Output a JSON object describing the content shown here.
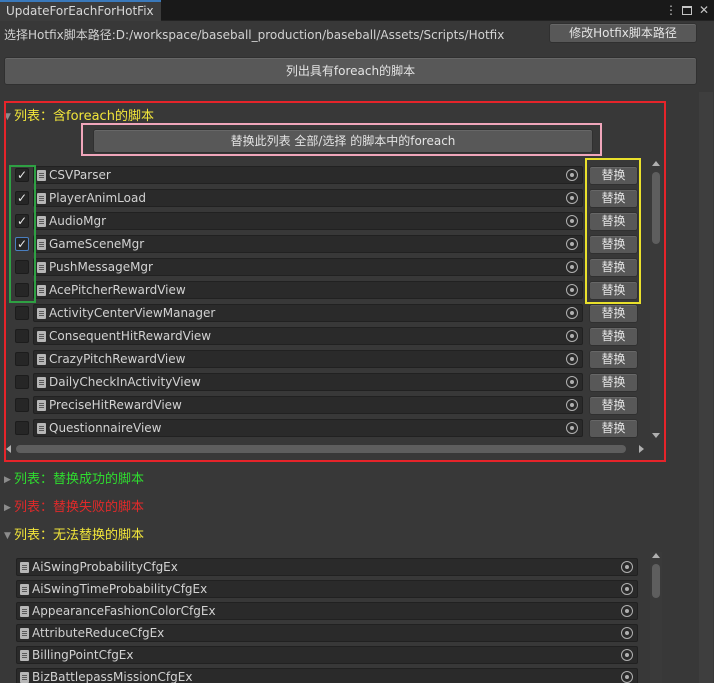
{
  "window": {
    "tab_title": "UpdateForEachForHotFix",
    "menu_icon": "kebab-menu-icon",
    "maximize_icon": "maximize-icon",
    "close_icon": "close-icon"
  },
  "header": {
    "path_label": "选择Hotfix脚本路径:",
    "path_value": "D:/workspace/baseball_production/baseball/Assets/Scripts/Hotfix",
    "modify_button": "修改Hotfix脚本路径",
    "list_button": "列出具有foreach的脚本"
  },
  "sections": {
    "foreach": {
      "label": "列表：含foreach的脚本",
      "color": "#f2e63a",
      "expanded": true
    },
    "success": {
      "label": "列表：替换成功的脚本",
      "color": "#2fdc2f",
      "expanded": false
    },
    "failed": {
      "label": "列表：替换失败的脚本",
      "color": "#e02a2a",
      "expanded": false
    },
    "unable": {
      "label": "列表：无法替换的脚本",
      "color": "#f2e63a",
      "expanded": true
    }
  },
  "foreach_list": {
    "replace_all_button": "替换此列表 全部/选择 的脚本中的foreach",
    "replace_button_label": "替换",
    "check_mark": "✓",
    "items": [
      {
        "name": "CSVParser",
        "checked": true
      },
      {
        "name": "PlayerAnimLoad",
        "checked": true
      },
      {
        "name": "AudioMgr",
        "checked": true
      },
      {
        "name": "GameSceneMgr",
        "checked": true
      },
      {
        "name": "PushMessageMgr",
        "checked": false
      },
      {
        "name": "AcePitcherRewardView",
        "checked": false
      },
      {
        "name": "ActivityCenterViewManager",
        "checked": false
      },
      {
        "name": "ConsequentHitRewardView",
        "checked": false
      },
      {
        "name": "CrazyPitchRewardView",
        "checked": false
      },
      {
        "name": "DailyCheckInActivityView",
        "checked": false
      },
      {
        "name": "PreciseHitRewardView",
        "checked": false
      },
      {
        "name": "QuestionnaireView",
        "checked": false
      }
    ]
  },
  "unable_list": {
    "items": [
      "AiSwingProbabilityCfgEx",
      "AiSwingTimeProbabilityCfgEx",
      "AppearanceFashionColorCfgEx",
      "AttributeReduceCfgEx",
      "BillingPointCfgEx",
      "BizBattlepassMissionCfgEx"
    ]
  },
  "annotation_colors": {
    "panel_border": "#e6242a",
    "replace_all_border": "#f0a6bb",
    "checkbox_group_border": "#2ea043",
    "replace_buttons_border": "#e9e02c"
  }
}
